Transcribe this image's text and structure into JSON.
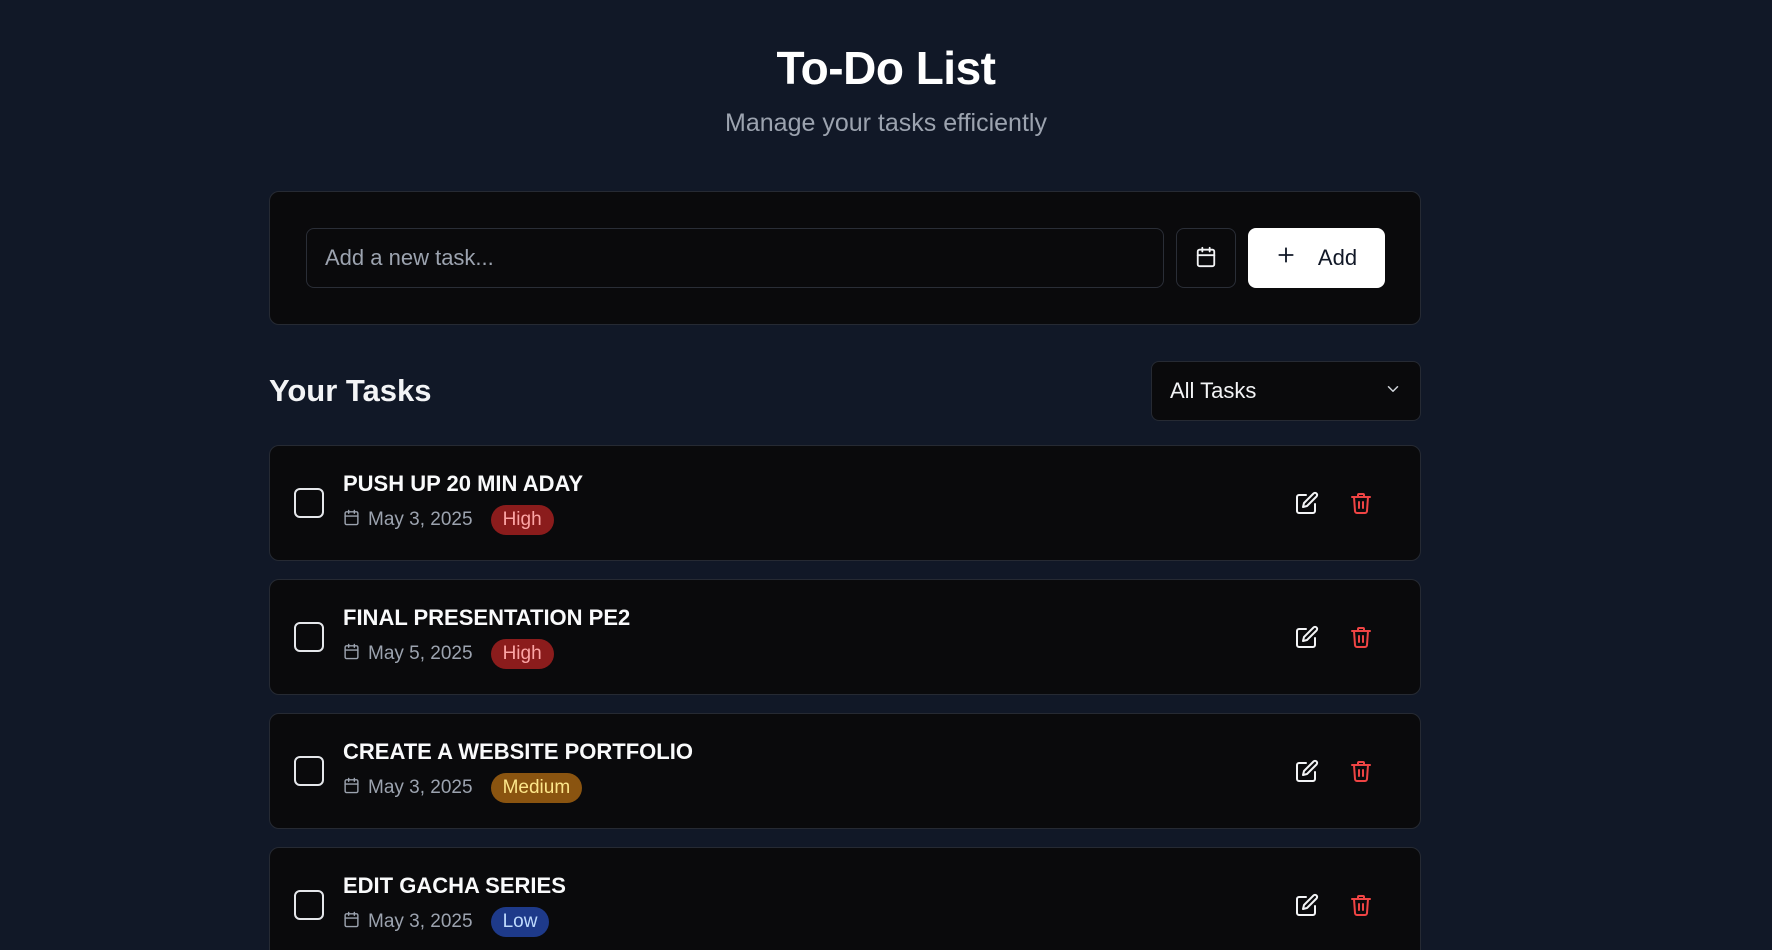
{
  "header": {
    "title": "To-Do List",
    "subtitle": "Manage your tasks efficiently"
  },
  "add_task": {
    "placeholder": "Add a new task...",
    "date_button_icon": "calendar-icon",
    "add_label": "Add",
    "add_icon": "plus-icon"
  },
  "tasks_section": {
    "title": "Your Tasks",
    "filter": {
      "selected": "All Tasks",
      "icon": "chevron-down-icon"
    }
  },
  "tasks": [
    {
      "title": "PUSH UP 20 MIN ADAY",
      "date": "May 3, 2025",
      "priority": "High",
      "priority_level": "high"
    },
    {
      "title": "FINAL PRESENTATION PE2",
      "date": "May 5, 2025",
      "priority": "High",
      "priority_level": "high"
    },
    {
      "title": "CREATE A WEBSITE PORTFOLIO",
      "date": "May 3, 2025",
      "priority": "Medium",
      "priority_level": "medium"
    },
    {
      "title": "EDIT GACHA SERIES",
      "date": "May 3, 2025",
      "priority": "Low",
      "priority_level": "low"
    }
  ],
  "colors": {
    "background": "#111827",
    "card": "#0a0a0c",
    "high": "#8b1c1c",
    "medium": "#8a5410",
    "low": "#1e3a8a",
    "delete": "#ef4444"
  }
}
